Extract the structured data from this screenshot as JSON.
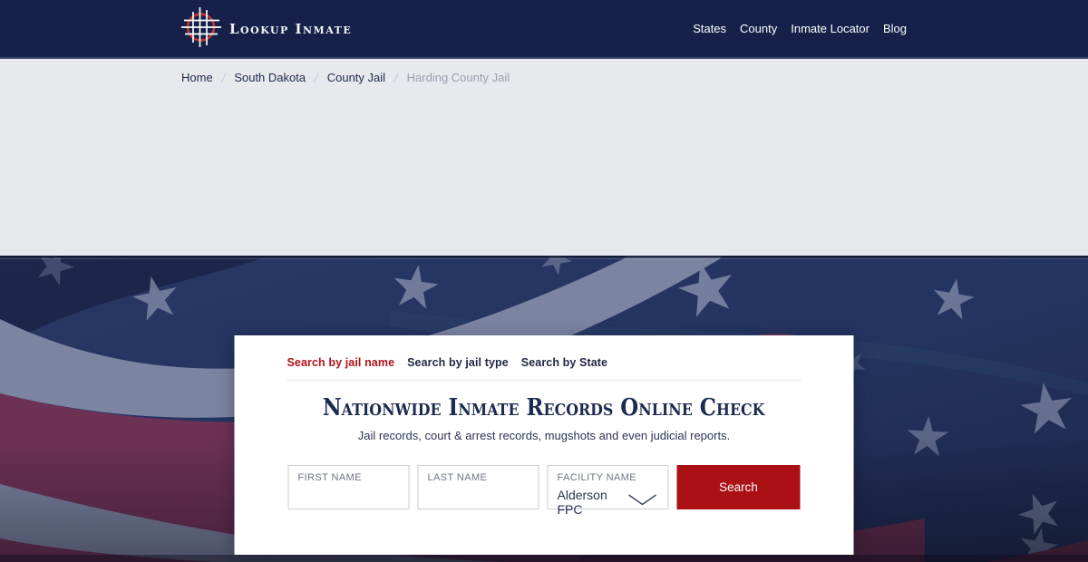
{
  "header": {
    "logo_text": "Lookup Inmate",
    "logo_icon": "grid-crosshair-logo-icon",
    "nav": [
      {
        "label": "States"
      },
      {
        "label": "County"
      },
      {
        "label": "Inmate Locator"
      },
      {
        "label": "Blog"
      }
    ]
  },
  "breadcrumb": {
    "separator": "/",
    "items": [
      {
        "label": "Home",
        "muted": false
      },
      {
        "label": "South Dakota",
        "muted": false
      },
      {
        "label": "County Jail",
        "muted": false
      },
      {
        "label": "Harding County Jail",
        "muted": true
      }
    ]
  },
  "hero": {
    "background": "american-flag-photo",
    "search_card": {
      "tabs": [
        {
          "label": "Search by jail name",
          "active": true
        },
        {
          "label": "Search by jail type",
          "active": false
        },
        {
          "label": "Search by State",
          "active": false
        }
      ],
      "title": "Nationwide Inmate Records Online Check",
      "subtitle": "Jail records, court & arrest records, mugshots and even judicial reports.",
      "form": {
        "first_name": {
          "label": "FIRST NAME",
          "value": ""
        },
        "last_name": {
          "label": "LAST NAME",
          "value": ""
        },
        "facility": {
          "label": "FACILITY NAME",
          "value": "Alderson FPC",
          "icon": "chevron-down-icon"
        },
        "submit_label": "Search"
      }
    }
  },
  "colors": {
    "header_navy": "#152149",
    "accent_red": "#b01217",
    "button_red": "#ab1014",
    "title_navy": "#1c2b4f",
    "section_gray": "#e7e9ed",
    "flag_blue": "#253461",
    "flag_stripe_gray": "#7b84a1",
    "flag_stripe_mauve": "#6e3156"
  }
}
